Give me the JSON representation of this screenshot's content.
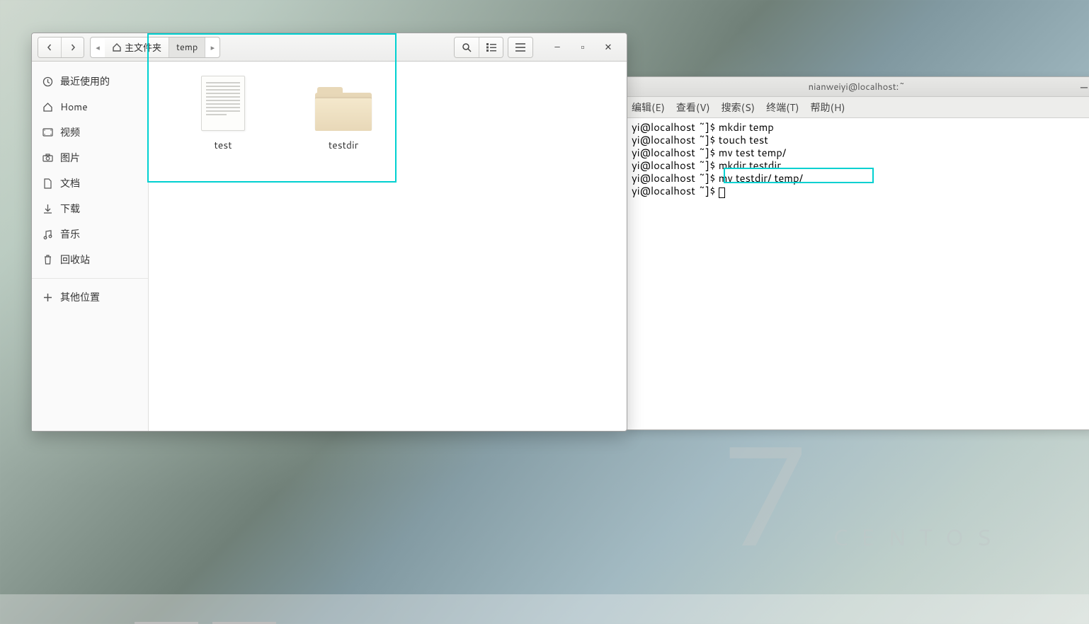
{
  "desktop": {
    "os_label": "CENTOS",
    "os_version": "7"
  },
  "file_manager": {
    "breadcrumb": {
      "root_label": "主文件夹",
      "current": "temp"
    },
    "sidebar": [
      {
        "icon": "clock",
        "label": "最近使用的"
      },
      {
        "icon": "home",
        "label": "Home"
      },
      {
        "icon": "video",
        "label": "视频"
      },
      {
        "icon": "camera",
        "label": "图片"
      },
      {
        "icon": "document",
        "label": "文档"
      },
      {
        "icon": "download",
        "label": "下载"
      },
      {
        "icon": "music",
        "label": "音乐"
      },
      {
        "icon": "trash",
        "label": "回收站"
      },
      {
        "icon": "plus",
        "label": "其他位置"
      }
    ],
    "items": [
      {
        "type": "file",
        "name": "test"
      },
      {
        "type": "folder",
        "name": "testdir"
      }
    ]
  },
  "terminal": {
    "title": "nianweiyi@localhost:~",
    "menu": [
      "编辑(E)",
      "查看(V)",
      "搜索(S)",
      "终端(T)",
      "帮助(H)"
    ],
    "prompt": "yi@localhost ~]$ ",
    "lines": [
      "mkdir temp",
      "touch test",
      "mv test temp/",
      "mkdir testdir",
      "mv testdir/ temp/",
      ""
    ]
  }
}
